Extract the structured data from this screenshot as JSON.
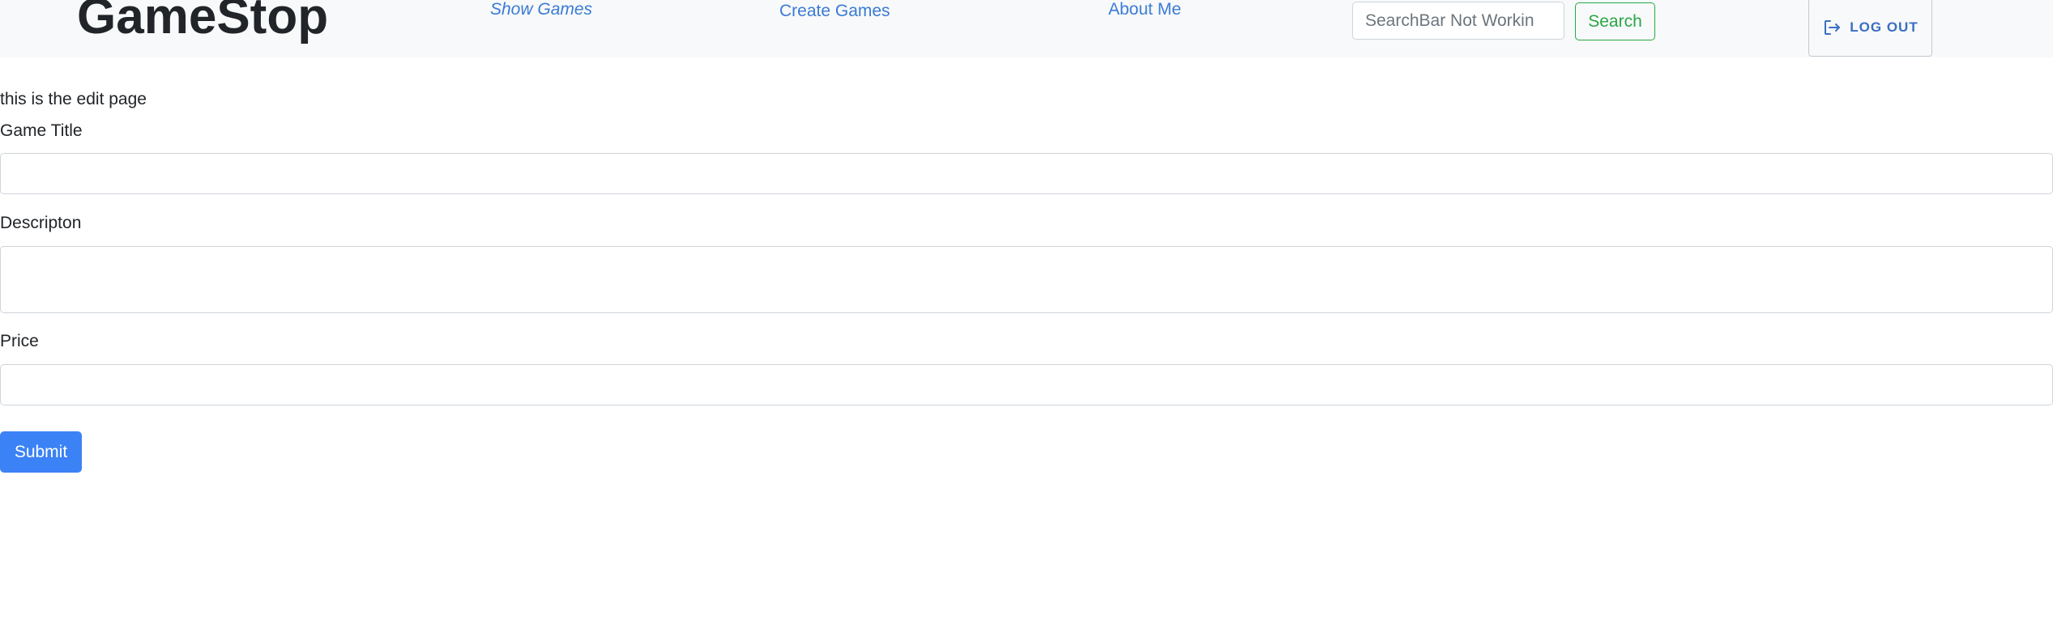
{
  "navbar": {
    "brand": "GameStop",
    "links": [
      {
        "label": "Show Games"
      },
      {
        "label": "Create Games"
      },
      {
        "label": "About Me"
      }
    ],
    "search": {
      "placeholder": "SearchBar Not Workin",
      "value": "",
      "button_label": "Search"
    },
    "logout": {
      "label": "LOG OUT",
      "icon": "logout-icon"
    }
  },
  "main": {
    "heading": "this is the edit page",
    "fields": [
      {
        "label": "Game Title",
        "value": ""
      },
      {
        "label": "Descripton",
        "value": ""
      },
      {
        "label": "Price",
        "value": ""
      }
    ],
    "submit_label": "Submit"
  },
  "colors": {
    "navbar_bg": "#f8f9fa",
    "link": "#3a7bd5",
    "search_button": "#28a745",
    "submit_button": "#3b82f6"
  }
}
